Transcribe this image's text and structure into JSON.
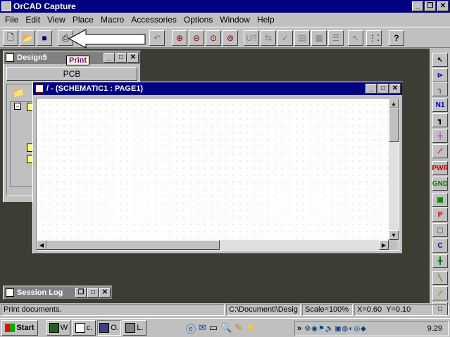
{
  "app": {
    "title": "OrCAD Capture",
    "icon": "orcad-icon"
  },
  "menu": [
    "File",
    "Edit",
    "View",
    "Place",
    "Macro",
    "Accessories",
    "Options",
    "Window",
    "Help"
  ],
  "toolbar": {
    "tooltip": "Print",
    "buttons": [
      "new-icon",
      "open-icon",
      "save-icon",
      "print-icon",
      "undo-icon",
      "redo-icon",
      "zoom-in-icon",
      "zoom-out-icon",
      "zoom-area-icon",
      "zoom-all-icon",
      "annotate-icon",
      "backannotate-icon",
      "drc-icon",
      "netlist-icon",
      "crossref-icon",
      "bom-icon",
      "pointer-icon",
      "snap-grid-icon",
      "help-icon"
    ]
  },
  "design_window": {
    "title": "Design5",
    "tab": "PCB"
  },
  "schematic_window": {
    "title": "/ - (SCHEMATIC1 : PAGE1)"
  },
  "session_log": {
    "title": "Session Log"
  },
  "palette": [
    {
      "icon": "select-icon",
      "label": ""
    },
    {
      "icon": "place-part-icon",
      "label": ""
    },
    {
      "icon": "place-wire-icon",
      "label": ""
    },
    {
      "icon": "net-alias-icon",
      "label": "N1"
    },
    {
      "icon": "place-bus-icon",
      "label": ""
    },
    {
      "icon": "junction-icon",
      "label": ""
    },
    {
      "icon": "bus-entry-icon",
      "label": ""
    },
    {
      "icon": "power-icon",
      "label": "PWR"
    },
    {
      "icon": "ground-icon",
      "label": "GND"
    },
    {
      "icon": "hierarchical-block-icon",
      "label": ""
    },
    {
      "icon": "hierarchical-port-icon",
      "label": "P"
    },
    {
      "icon": "hierarchical-pin-icon",
      "label": ""
    },
    {
      "icon": "off-page-connector-icon",
      "label": "C"
    },
    {
      "icon": "no-connect-icon",
      "label": ""
    },
    {
      "icon": "place-line-icon",
      "label": ""
    },
    {
      "icon": "place-polyline-icon",
      "label": ""
    },
    {
      "icon": "place-rectangle-icon",
      "label": ""
    }
  ],
  "status": {
    "message": "Print documents.",
    "path": "C:\\Documenti\\Desig",
    "scale": "Scale=100%",
    "coords": "X=0.60  Y=0.10"
  },
  "taskbar": {
    "start": "Start",
    "tasks": [
      {
        "icon": "word-icon",
        "label": "W"
      },
      {
        "icon": "doc-icon",
        "label": "c."
      },
      {
        "icon": "orcad-icon",
        "label": "O."
      },
      {
        "icon": "layout-icon",
        "label": "L."
      }
    ],
    "tray_chevron": "»",
    "time": "9.29"
  }
}
